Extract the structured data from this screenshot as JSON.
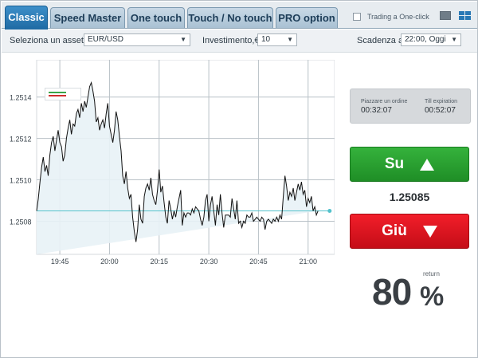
{
  "tabs": [
    {
      "label": "Classic",
      "active": true
    },
    {
      "label": "Speed Master",
      "active": false
    },
    {
      "label": "One touch",
      "active": false
    },
    {
      "label": "Touch / No touch",
      "active": false
    },
    {
      "label": "PRO option",
      "active": false
    }
  ],
  "one_click": {
    "label": "Trading a One-click",
    "checked": false
  },
  "view_icons": [
    "single-view-icon",
    "grid-view-icon"
  ],
  "settings": {
    "asset_label": "Seleziona un asset",
    "asset_value": "EUR/USD",
    "invest_label": "Investimento,€",
    "invest_value": "10",
    "expiry_label": "Scadenza a",
    "expiry_value": "22:00, Oggi"
  },
  "timers": {
    "order_label": "Piazzare un ordine",
    "order_value": "00:32:07",
    "expiry_label": "Till expiration",
    "expiry_value": "00:52:07"
  },
  "buttons": {
    "up_label": "Su",
    "down_label": "Giù"
  },
  "current_price": "1.25085",
  "payout": {
    "value": "80",
    "unit": "%",
    "label": "return"
  },
  "colors": {
    "up": "#2a9e30",
    "down": "#e0141f",
    "tab_active": "#2a7db9",
    "line": "#111111",
    "area": "#e8f2f6",
    "reference": "#53c2cc"
  },
  "chart_data": {
    "type": "line",
    "x_tick_labels": [
      "19:45",
      "20:00",
      "20:15",
      "20:30",
      "20:45",
      "21:00"
    ],
    "x_ticks_minutes": [
      0,
      15,
      30,
      45,
      60,
      75
    ],
    "y_tick_labels": [
      "1.2514",
      "1.2512",
      "1.2510",
      "1.2508"
    ],
    "y_ticks": [
      1.2514,
      1.2512,
      1.251,
      1.2508
    ],
    "ylim": [
      1.25064,
      1.25158
    ],
    "xlim_minutes": [
      -7,
      83
    ],
    "reference_line": 1.25085,
    "grid": true,
    "x_minutes": [
      -7,
      -6.5,
      -6,
      -5.5,
      -5,
      -4.5,
      -4,
      -3.5,
      -3,
      -2.5,
      -2,
      -1.5,
      -1,
      -0.5,
      0,
      0.5,
      1,
      1.5,
      2,
      2.5,
      3,
      3.5,
      4,
      4.5,
      5,
      5.5,
      6,
      6.5,
      7,
      7.5,
      8,
      8.5,
      9,
      9.5,
      10,
      10.5,
      11,
      11.5,
      12,
      12.5,
      13,
      13.5,
      14,
      14.5,
      15,
      15.5,
      16,
      16.5,
      17,
      17.5,
      18,
      18.5,
      19,
      19.5,
      20,
      20.5,
      21,
      21.5,
      22,
      22.5,
      23,
      23.5,
      24,
      24.5,
      25,
      25.5,
      26,
      26.5,
      27,
      27.5,
      28,
      28.5,
      29,
      29.5,
      30,
      30.5,
      31,
      31.5,
      32,
      32.5,
      33,
      33.5,
      34,
      34.5,
      35,
      35.5,
      36,
      36.5,
      37,
      37.5,
      38,
      38.5,
      39,
      39.5,
      40,
      40.5,
      41,
      41.5,
      42,
      42.5,
      43,
      43.5,
      44,
      44.5,
      45,
      45.5,
      46,
      46.5,
      47,
      47.5,
      48,
      48.5,
      49,
      49.5,
      50,
      50.5,
      51,
      51.5,
      52,
      52.5,
      53,
      53.5,
      54,
      54.5,
      55,
      55.5,
      56,
      56.5,
      57,
      57.5,
      58,
      58.5,
      59,
      59.5,
      60,
      60.5,
      61,
      61.5,
      62,
      62.5,
      63,
      63.5,
      64,
      64.5,
      65,
      65.5,
      66,
      66.5,
      67,
      67.5,
      68,
      68.5,
      69,
      69.5,
      70,
      70.5,
      71,
      71.5,
      72,
      72.5,
      73,
      73.5,
      74,
      74.5,
      75,
      75.5,
      76,
      76.5,
      77,
      77.5,
      78,
      78.5,
      79,
      79.5,
      80,
      80.5,
      81,
      81.5
    ],
    "values": [
      1.25085,
      1.25091,
      1.25099,
      1.25106,
      1.25111,
      1.25104,
      1.25107,
      1.25102,
      1.25112,
      1.25118,
      1.25121,
      1.25114,
      1.25119,
      1.25124,
      1.25118,
      1.25116,
      1.25109,
      1.25112,
      1.2512,
      1.25125,
      1.25129,
      1.25122,
      1.25127,
      1.25126,
      1.25132,
      1.25134,
      1.2513,
      1.25137,
      1.25133,
      1.25138,
      1.25135,
      1.2514,
      1.25145,
      1.25147,
      1.25143,
      1.25138,
      1.25128,
      1.2513,
      1.25124,
      1.25127,
      1.25129,
      1.25125,
      1.25132,
      1.25137,
      1.25126,
      1.25122,
      1.25118,
      1.25124,
      1.25133,
      1.25129,
      1.25121,
      1.25114,
      1.25102,
      1.25098,
      1.25104,
      1.25096,
      1.25091,
      1.25093,
      1.25082,
      1.25075,
      1.2507,
      1.25076,
      1.25088,
      1.25081,
      1.25079,
      1.25092,
      1.25096,
      1.25098,
      1.25095,
      1.25101,
      1.25093,
      1.2509,
      1.25088,
      1.25095,
      1.25105,
      1.25094,
      1.25097,
      1.25089,
      1.25082,
      1.25079,
      1.2509,
      1.25086,
      1.25081,
      1.25085,
      1.25082,
      1.25087,
      1.25091,
      1.25095,
      1.25078,
      1.25084,
      1.25082,
      1.25084,
      1.25084,
      1.25083,
      1.25086,
      1.25084,
      1.25087,
      1.25086,
      1.25085,
      1.25081,
      1.25078,
      1.25082,
      1.2509,
      1.25093,
      1.2508,
      1.25088,
      1.25092,
      1.25085,
      1.25078,
      1.25088,
      1.25083,
      1.25093,
      1.25084,
      1.25077,
      1.25083,
      1.25083,
      1.25083,
      1.25082,
      1.25091,
      1.25086,
      1.25081,
      1.2509,
      1.25079,
      1.2508,
      1.25077,
      1.2508,
      1.25079,
      1.25083,
      1.25082,
      1.25082,
      1.25084,
      1.2508,
      1.25081,
      1.25082,
      1.25081,
      1.2508,
      1.25082,
      1.25081,
      1.25076,
      1.2508,
      1.25081,
      1.2508,
      1.25079,
      1.25081,
      1.2508,
      1.25082,
      1.2508,
      1.25083,
      1.25081,
      1.25092,
      1.25102,
      1.25097,
      1.2509,
      1.25094,
      1.25092,
      1.25096,
      1.2509,
      1.25094,
      1.25098,
      1.25095,
      1.25099,
      1.25093,
      1.25095,
      1.25087,
      1.25091,
      1.25089,
      1.25092,
      1.25085,
      1.25087,
      1.25083,
      1.25085
    ]
  }
}
